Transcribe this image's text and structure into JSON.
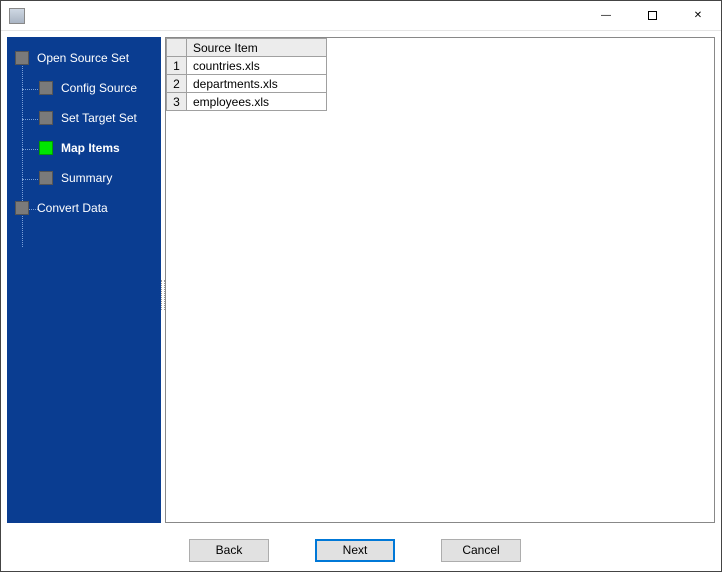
{
  "window": {
    "title": ""
  },
  "sidebar": {
    "items": [
      {
        "label": "Open Source Set",
        "level": 0,
        "active": false
      },
      {
        "label": "Config Source",
        "level": 1,
        "active": false
      },
      {
        "label": "Set Target Set",
        "level": 1,
        "active": false
      },
      {
        "label": "Map Items",
        "level": 1,
        "active": true
      },
      {
        "label": "Summary",
        "level": 1,
        "active": false
      },
      {
        "label": "Convert Data",
        "level": 0,
        "active": false
      }
    ]
  },
  "table": {
    "header": "Source Item",
    "rows": [
      {
        "n": "1",
        "item": "countries.xls"
      },
      {
        "n": "2",
        "item": "departments.xls"
      },
      {
        "n": "3",
        "item": "employees.xls"
      }
    ]
  },
  "buttons": {
    "back": "Back",
    "next": "Next",
    "cancel": "Cancel"
  }
}
